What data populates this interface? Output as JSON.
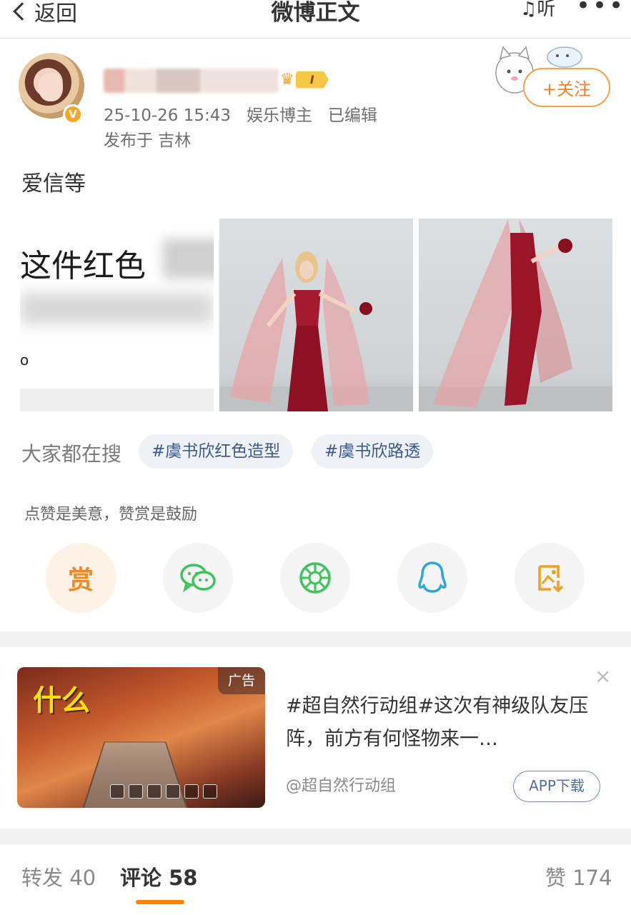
{
  "nav": {
    "back_label": "返回",
    "title": "微博正文",
    "listen_label": "听",
    "more_label": "•••"
  },
  "author": {
    "verified_mark": "V",
    "level_label": "I",
    "timestamp": "25-10-26 15:43",
    "role": "娱乐博主",
    "edited": "已编辑",
    "location": "发布于 吉林",
    "follow_label": "+关注"
  },
  "post": {
    "text": "爱信等",
    "image1_text": "这件红色",
    "image1_dot": "o"
  },
  "hot_search": {
    "label": "大家都在搜",
    "tags": [
      "#虞书欣红色造型",
      "#虞书欣路透"
    ]
  },
  "reward": {
    "tip": "点赞是美意，赞赏是鼓励",
    "reward_char": "赏"
  },
  "share_icons": [
    "reward-icon",
    "wechat-icon",
    "moments-icon",
    "qq-icon",
    "save-image-icon"
  ],
  "ad": {
    "thumb_text": "什么",
    "badge": "广告",
    "title": "#超自然行动组#这次有神级队友压阵，前方有何怪物来一…",
    "source": "@超自然行动组",
    "download_label": "APP下载",
    "close_label": "×"
  },
  "tabs": {
    "repost": "转发 40",
    "comment": "评论 58",
    "like": "赞 174"
  },
  "colors": {
    "accent_orange": "#ff8200",
    "follow_orange": "#f5822a",
    "tag_blue": "#3c5a88",
    "wechat_green": "#3fc35a",
    "qq_blue": "#2aa6e0",
    "save_orange": "#f0a020"
  }
}
